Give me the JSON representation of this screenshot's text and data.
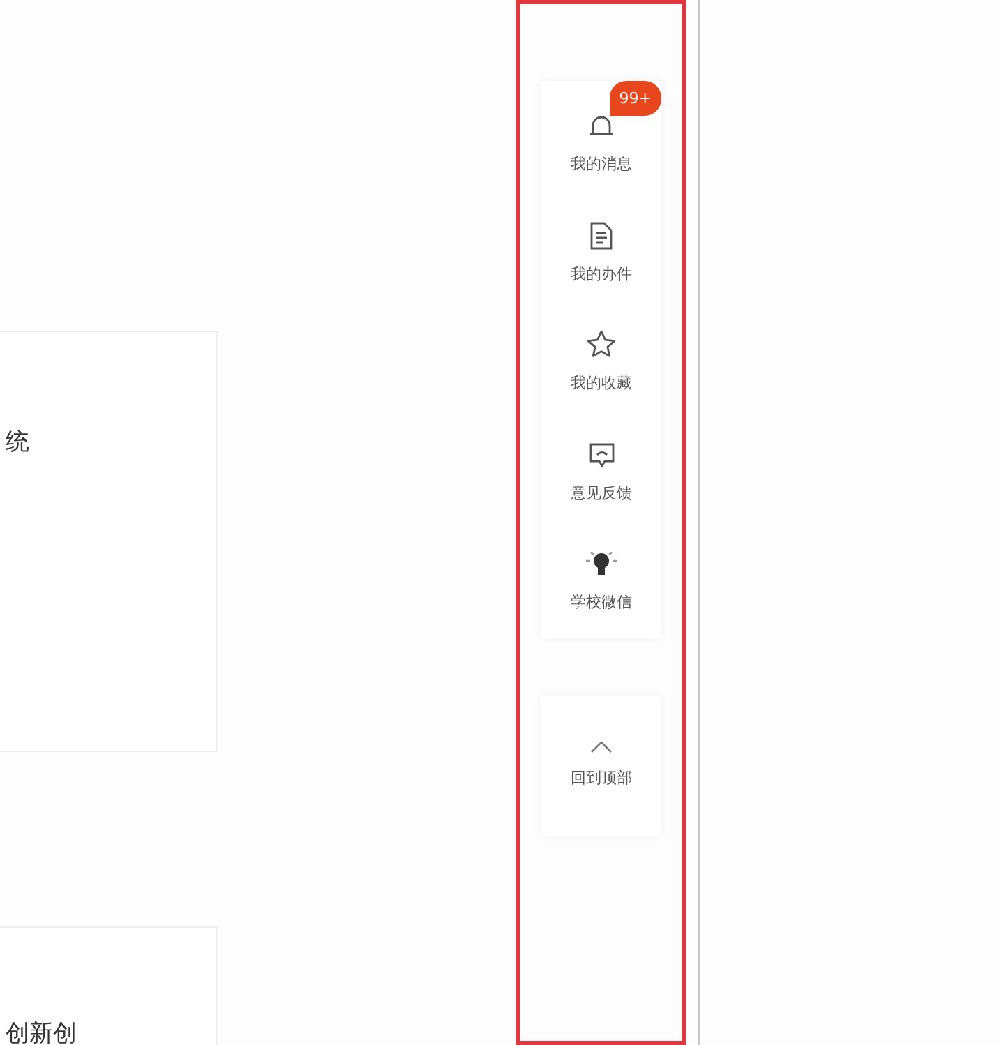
{
  "cards": [
    {
      "text": "统"
    },
    {
      "text": "创新创"
    }
  ],
  "side_menu": {
    "items": [
      {
        "kind": "bell",
        "label": "我的消息",
        "badge": "99+"
      },
      {
        "kind": "document",
        "label": "我的办件"
      },
      {
        "kind": "star",
        "label": "我的收藏"
      },
      {
        "kind": "feedback",
        "label": "意见反馈"
      },
      {
        "kind": "bulb",
        "label": "学校微信"
      }
    ]
  },
  "back_to_top": {
    "label": "回到顶部"
  }
}
